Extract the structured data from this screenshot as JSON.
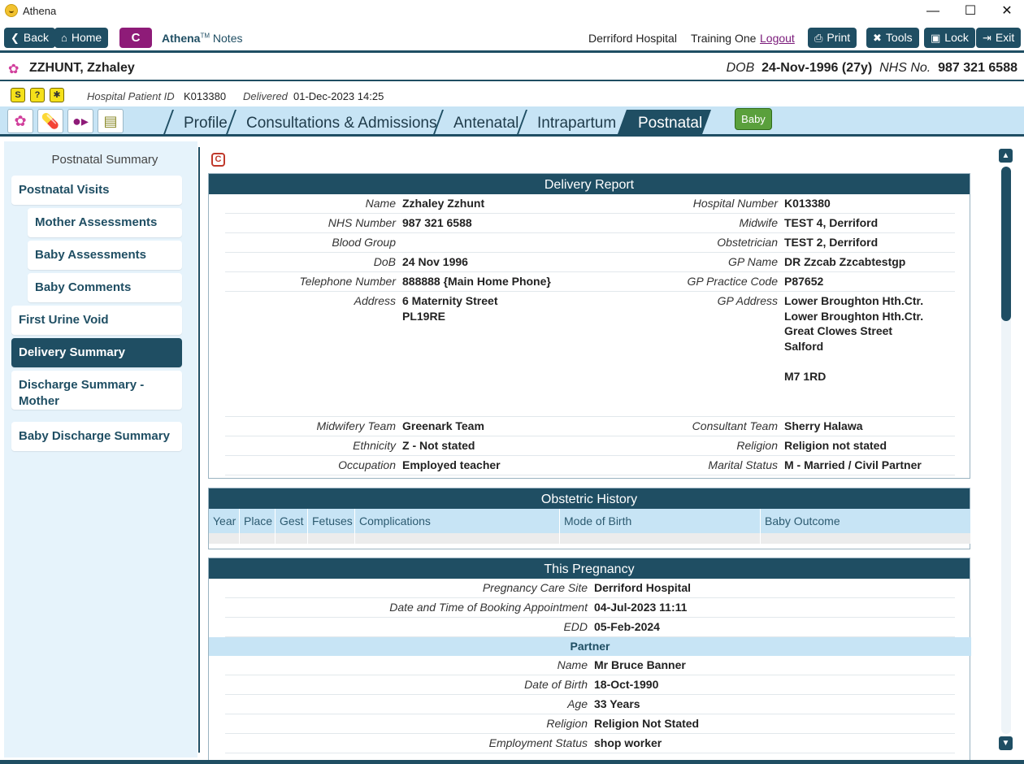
{
  "window": {
    "title": "Athena",
    "minimize": "—",
    "maximize": "☐",
    "close": "✕"
  },
  "toolbar": {
    "back": "Back",
    "home": "Home",
    "c": "C",
    "app_name": "Athena",
    "app_tm": "TM",
    "app_suffix": "Notes",
    "hospital": "Derriford Hospital",
    "user": "Training One",
    "logout": "Logout",
    "print": "Print",
    "tools": "Tools",
    "lock": "Lock",
    "exit": "Exit"
  },
  "patient": {
    "name": "ZZHUNT, Zzhaley",
    "dob_label": "DOB",
    "dob": "24-Nov-1996 (27y)",
    "nhs_label": "NHS No.",
    "nhs": "987 321 6588"
  },
  "info": {
    "hospital_id_label": "Hospital Patient ID",
    "hospital_id": "K013380",
    "delivered_label": "Delivered",
    "delivered": "01-Dec-2023 14:25"
  },
  "tabs": [
    "Profile",
    "Consultations & Admissions",
    "Antenatal",
    "Intrapartum",
    "Postnatal"
  ],
  "baby_button": "Baby",
  "nav": {
    "title": "Postnatal Summary",
    "items": [
      "Postnatal Visits",
      "Mother Assessments",
      "Baby Assessments",
      "Baby Comments",
      "First Urine Void",
      "Delivery Summary",
      "Discharge Summary - Mother",
      "Baby Discharge Summary"
    ]
  },
  "content": {
    "c_badge": "C",
    "delivery": {
      "title": "Delivery Report",
      "left": [
        {
          "label": "Name",
          "value": "Zzhaley Zzhunt"
        },
        {
          "label": "NHS Number",
          "value": "987 321 6588"
        },
        {
          "label": "Blood Group",
          "value": ""
        },
        {
          "label": "DoB",
          "value": "24 Nov 1996"
        },
        {
          "label": "Telephone Number",
          "value": "888888 {Main Home Phone}"
        },
        {
          "label": "Address",
          "value": "6 Maternity Street",
          "value2": "PL19RE"
        },
        {
          "label": "Midwifery Team",
          "value": "Greenark Team"
        },
        {
          "label": "Ethnicity",
          "value": "Z - Not stated"
        },
        {
          "label": "Occupation",
          "value": "Employed teacher"
        }
      ],
      "right": [
        {
          "label": "Hospital Number",
          "value": "K013380"
        },
        {
          "label": "Midwife",
          "value": "TEST 4, Derriford"
        },
        {
          "label": "Obstetrician",
          "value": "TEST 2, Derriford"
        },
        {
          "label": "GP Name",
          "value": "DR Zzcab Zzcabtestgp"
        },
        {
          "label": "GP Practice Code",
          "value": "P87652"
        },
        {
          "label": "GP Address",
          "lines": [
            "Lower Broughton Hth.Ctr.",
            "Lower Broughton Hth.Ctr.",
            "Great Clowes Street",
            "Salford",
            "",
            "M7 1RD"
          ]
        },
        {
          "label": "Consultant Team",
          "value": "Sherry Halawa"
        },
        {
          "label": "Religion",
          "value": "Religion not stated"
        },
        {
          "label": "Marital Status",
          "value": "M - Married / Civil Partner"
        }
      ]
    },
    "obstetric": {
      "title": "Obstetric History",
      "columns": [
        "Year",
        "Place",
        "Gest",
        "Fetuses",
        "Complications",
        "Mode of Birth",
        "Baby Outcome"
      ]
    },
    "pregnancy": {
      "title": "This Pregnancy",
      "rows": [
        {
          "label": "Pregnancy Care Site",
          "value": "Derriford Hospital"
        },
        {
          "label": "Date and Time of Booking Appointment",
          "value": "04-Jul-2023 11:11"
        },
        {
          "label": "EDD",
          "value": "05-Feb-2024"
        }
      ],
      "partner_title": "Partner",
      "partner_rows": [
        {
          "label": "Name",
          "value": "Mr Bruce Banner"
        },
        {
          "label": "Date of Birth",
          "value": "18-Oct-1990"
        },
        {
          "label": "Age",
          "value": "33 Years"
        },
        {
          "label": "Religion",
          "value": "Religion Not Stated"
        },
        {
          "label": "Employment Status",
          "value": "shop worker"
        }
      ]
    }
  },
  "colors": {
    "primary": "#1f4e63",
    "accent_purple": "#8e1b78",
    "light_blue": "#c7e4f5",
    "baby_green": "#5aa03c"
  }
}
